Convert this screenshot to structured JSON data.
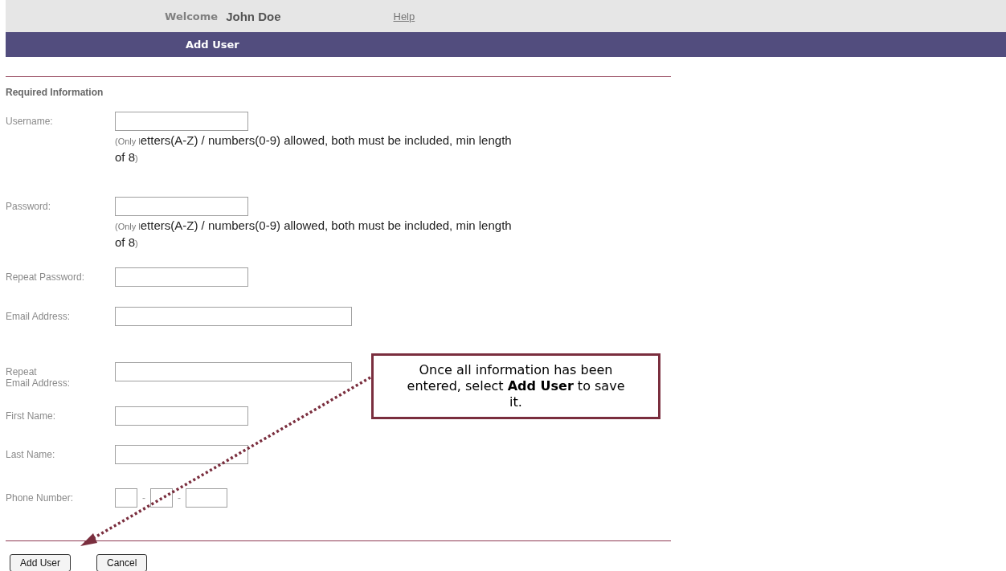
{
  "header": {
    "welcome": "Welcome",
    "user": "John Doe",
    "help_link": "Help"
  },
  "title_bar": {
    "title": "Add User"
  },
  "section": {
    "title": "Required Information"
  },
  "fields": [
    {
      "kind": "hinted",
      "label": "Username:",
      "hint": {
        "start": "(Only l",
        "main": "etters(A-Z) / numbers(0-9) allowed, both must be included, min length of 8",
        "end": ")"
      }
    },
    {
      "kind": "hinted",
      "label": "Password:",
      "hint": {
        "start": "(Only l",
        "main": "etters(A-Z) / numbers(0-9) allowed, both must be included, min length of 8",
        "end": ")"
      }
    },
    {
      "kind": "text",
      "label": "Repeat Password:"
    },
    {
      "kind": "wide_text",
      "label": "Email Address:"
    },
    {
      "kind": "wide_text",
      "label": "Repeat\nEmail Address:"
    },
    {
      "kind": "text",
      "label": "First Name:"
    },
    {
      "kind": "text",
      "label": "Last Name:"
    },
    {
      "kind": "phone",
      "label": "Phone Number:",
      "separators": [
        "-",
        "-"
      ]
    }
  ],
  "buttons": [
    "Add User",
    "Cancel"
  ],
  "callout": {
    "text": "Once all information has been entered, select **Add User** to save it."
  }
}
